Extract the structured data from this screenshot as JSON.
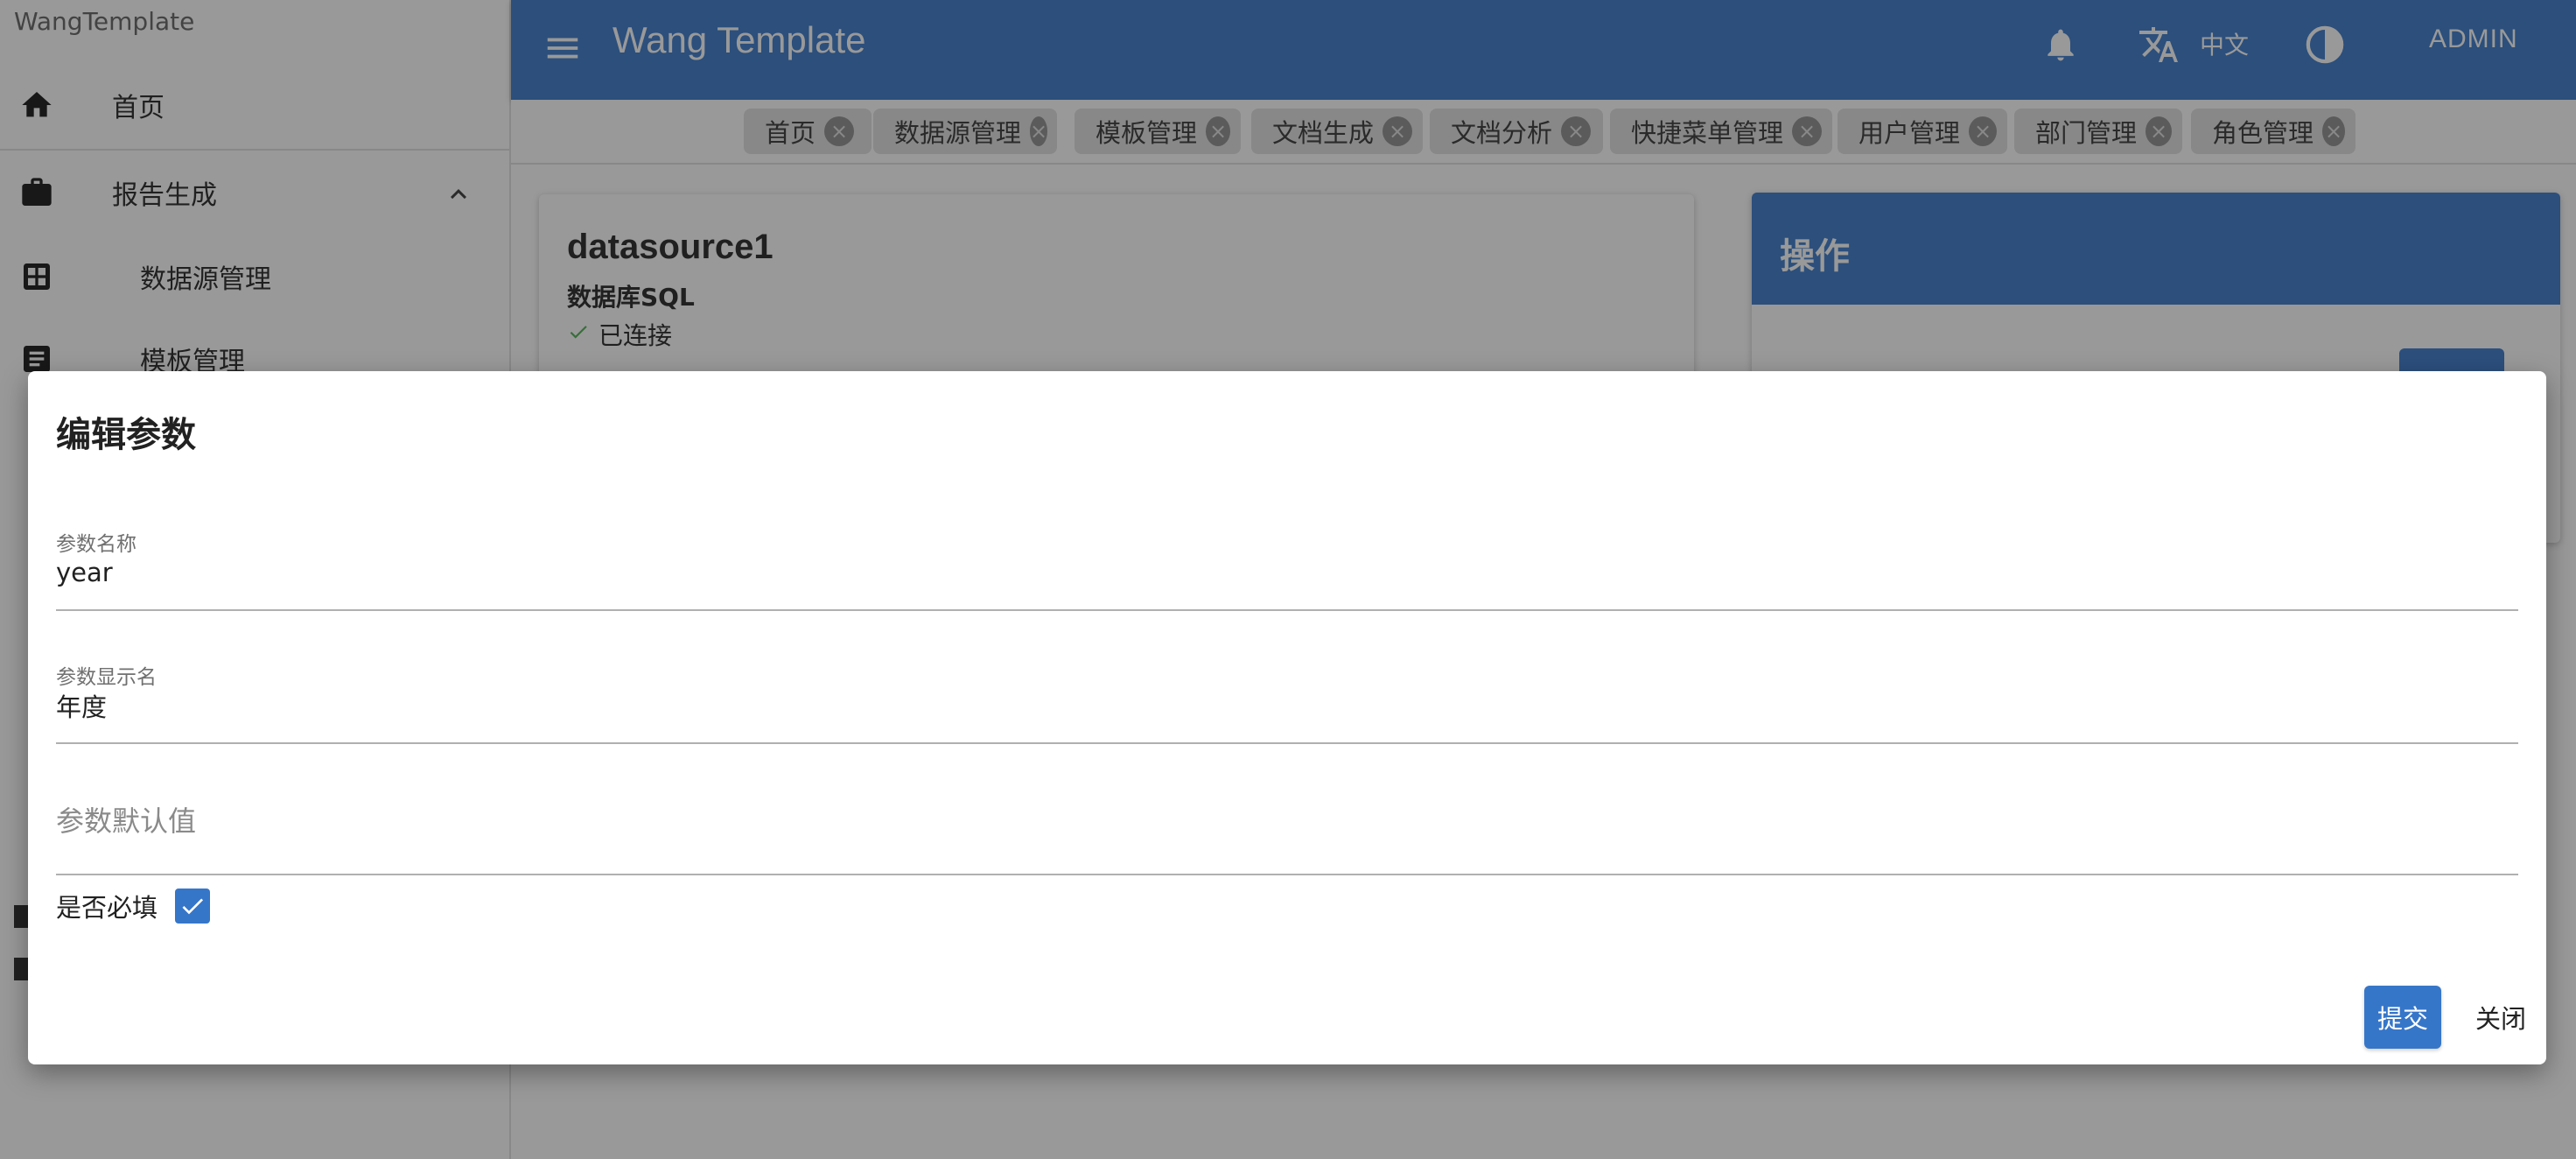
{
  "app": {
    "title": "WangTemplate",
    "header_title": "Wang Template",
    "language": "中文",
    "user": "ADMIN",
    "colors": {
      "primary": "#3676c9",
      "success": "#4caf50"
    }
  },
  "header_icons": [
    "menu-icon",
    "bell-icon",
    "translate-icon",
    "contrast-icon"
  ],
  "sidebar": {
    "items": [
      {
        "label": "首页",
        "icon": "home-icon"
      },
      {
        "label": "报告生成",
        "icon": "briefcase-icon",
        "expanded": true
      },
      {
        "label": "数据源管理",
        "icon": "grid-icon"
      },
      {
        "label": "模板管理",
        "icon": "document-icon"
      }
    ]
  },
  "tabs": [
    "首页",
    "数据源管理",
    "模板管理",
    "文档生成",
    "文档分析",
    "快捷菜单管理",
    "用户管理",
    "部门管理",
    "角色管理"
  ],
  "datasource": {
    "name": "datasource1",
    "type": "数据库SQL",
    "status": "已连接"
  },
  "operations": {
    "title": "操作"
  },
  "dialog": {
    "title": "编辑参数",
    "fields": [
      {
        "label": "参数名称",
        "value": "year"
      },
      {
        "label": "参数显示名",
        "value": "年度"
      },
      {
        "label": "",
        "value": "",
        "placeholder": "参数默认值"
      }
    ],
    "required_label": "是否必填",
    "required_checked": true,
    "submit_label": "提交",
    "close_label": "关闭"
  }
}
